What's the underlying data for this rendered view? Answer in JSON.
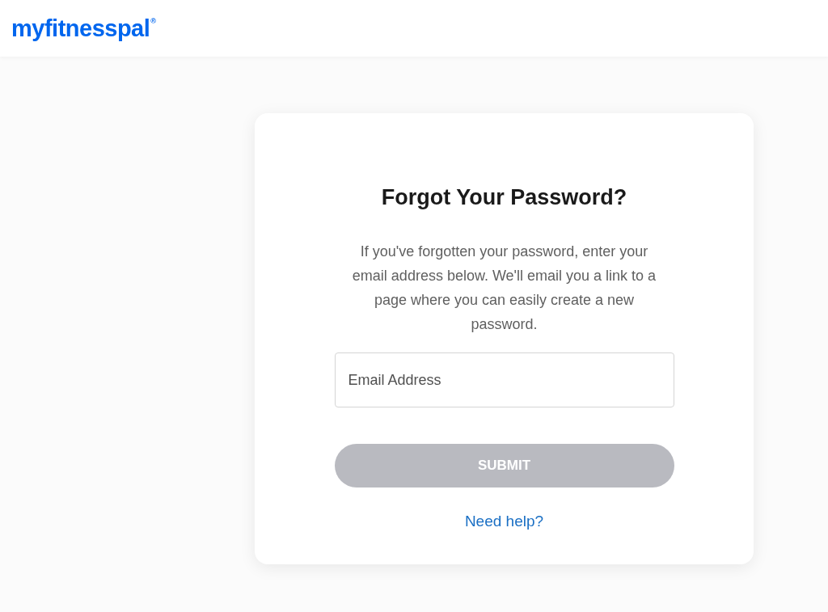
{
  "header": {
    "logo": "myfitnesspal",
    "logo_mark": "®"
  },
  "card": {
    "title": "Forgot Your Password?",
    "description": "If you've forgotten your password, enter your email address below. We'll email you a link to a page where you can easily create a new password.",
    "email_field": {
      "placeholder": "Email Address"
    },
    "submit": {
      "label": "SUBMIT",
      "disabled": true
    },
    "help_link": "Need help?"
  }
}
